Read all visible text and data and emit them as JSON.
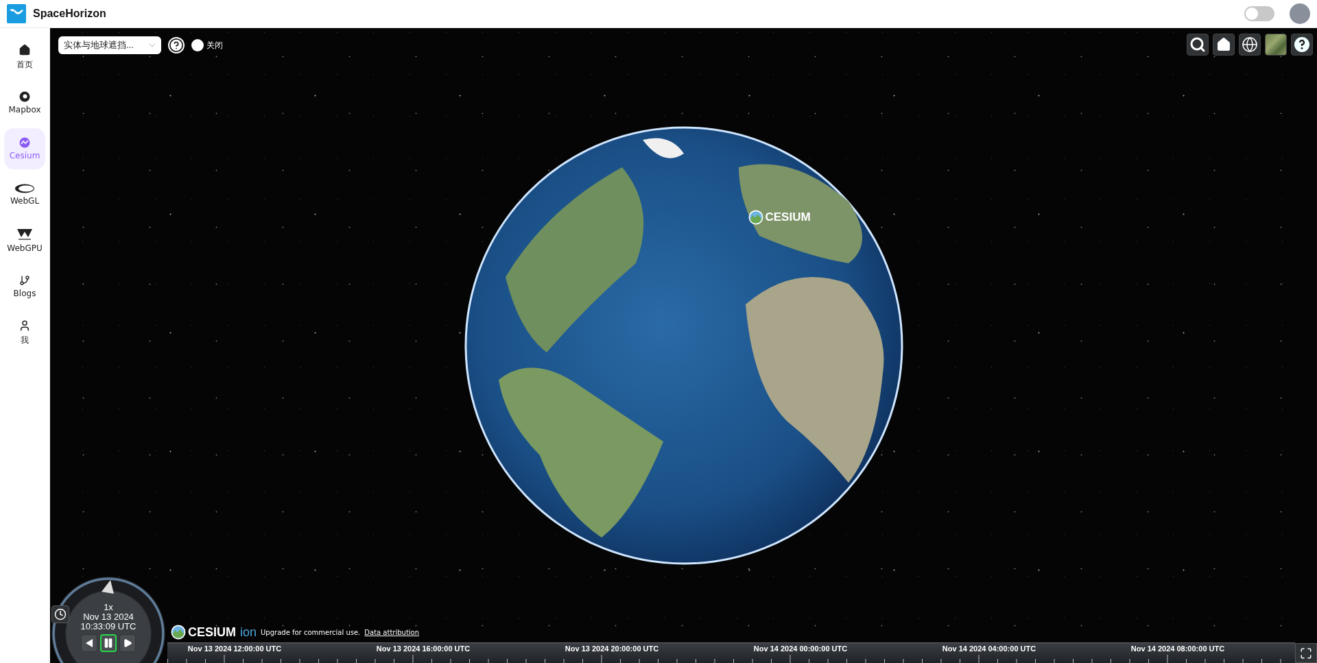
{
  "app": {
    "title": "SpaceHorizon"
  },
  "header": {
    "theme_toggle": {
      "on": false
    }
  },
  "sidebar": {
    "items": [
      {
        "label": "首页",
        "kind": "home",
        "selected": false
      },
      {
        "label": "Mapbox",
        "kind": "mapbox",
        "selected": false
      },
      {
        "label": "Cesium",
        "kind": "cesium",
        "selected": true
      },
      {
        "label": "WebGL",
        "kind": "webgl",
        "selected": false
      },
      {
        "label": "WebGPU",
        "kind": "webgpu",
        "selected": false
      },
      {
        "label": "Blogs",
        "kind": "blogs",
        "selected": false
      },
      {
        "label": "我",
        "kind": "user",
        "selected": false
      }
    ]
  },
  "map_toolbar": {
    "dropdown": {
      "value": "实体与地球遮挡..."
    },
    "switch": {
      "label": "关闭",
      "on": false
    }
  },
  "viewer_toolbar": {
    "buttons": [
      {
        "kind": "search"
      },
      {
        "kind": "home"
      },
      {
        "kind": "globe"
      },
      {
        "kind": "imagery"
      },
      {
        "kind": "help"
      }
    ]
  },
  "globe": {
    "label": "CESIUM"
  },
  "animation": {
    "speed": "1x",
    "date": "Nov 13 2024",
    "time": "10:33:09 UTC",
    "buttons": [
      {
        "kind": "reverse",
        "selected": false
      },
      {
        "kind": "pause",
        "selected": true
      },
      {
        "kind": "play",
        "selected": false
      }
    ]
  },
  "credits": {
    "logo": "CESIUM",
    "logo_suffix": "ion",
    "text": "Upgrade for commercial use.",
    "link": "Data attribution"
  },
  "timeline": {
    "labels": [
      "Nov 13 2024 12:00:00 UTC",
      "Nov 13 2024 16:00:00 UTC",
      "Nov 13 2024 20:00:00 UTC",
      "Nov 14 2024 00:00:00 UTC",
      "Nov 14 2024 04:00:00 UTC",
      "Nov 14 2024 08:00:00 UTC"
    ]
  }
}
